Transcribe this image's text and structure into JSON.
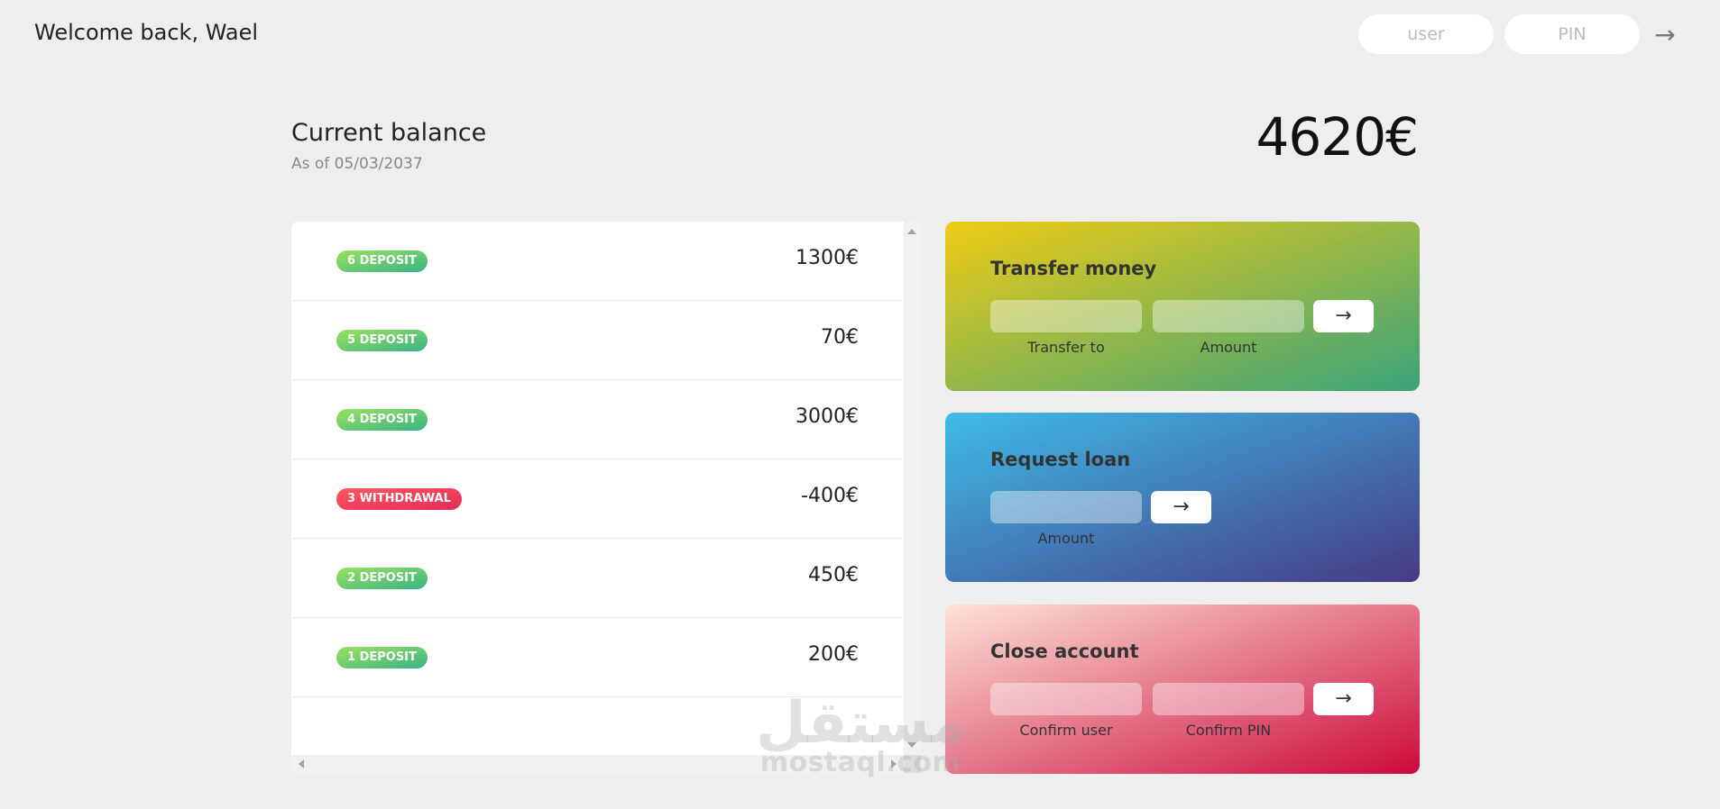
{
  "nav": {
    "welcome": "Welcome back, Wael",
    "user_placeholder": "user",
    "pin_placeholder": "PIN",
    "login_arrow": "→"
  },
  "balance": {
    "label": "Current balance",
    "date": "As of 05/03/2037",
    "value": "4620€"
  },
  "movements": [
    {
      "type": "deposit",
      "label": "6 deposit",
      "value": "1300€"
    },
    {
      "type": "deposit",
      "label": "5 deposit",
      "value": "70€"
    },
    {
      "type": "deposit",
      "label": "4 deposit",
      "value": "3000€"
    },
    {
      "type": "withdrawal",
      "label": "3 withdrawal",
      "value": "-400€"
    },
    {
      "type": "deposit",
      "label": "2 deposit",
      "value": "450€"
    },
    {
      "type": "deposit",
      "label": "1 deposit",
      "value": "200€"
    }
  ],
  "operations": {
    "transfer": {
      "title": "Transfer money",
      "label_to": "Transfer to",
      "label_amount": "Amount",
      "button": "→"
    },
    "loan": {
      "title": "Request loan",
      "label_amount": "Amount",
      "button": "→"
    },
    "close": {
      "title": "Close account",
      "label_user": "Confirm user",
      "label_pin": "Confirm PIN",
      "button": "→"
    }
  },
  "watermark": {
    "arabic": "مستقل",
    "latin": "mostaql.com"
  },
  "colors": {
    "deposit": "#39b385",
    "withdrawal": "#e52a5a",
    "transfer_gradient": [
      "#efcc16",
      "#3aa37a"
    ],
    "loan_gradient": [
      "#3fbce8",
      "#463a86"
    ],
    "close_gradient": [
      "#fde3d9",
      "#cc0a3c"
    ]
  }
}
